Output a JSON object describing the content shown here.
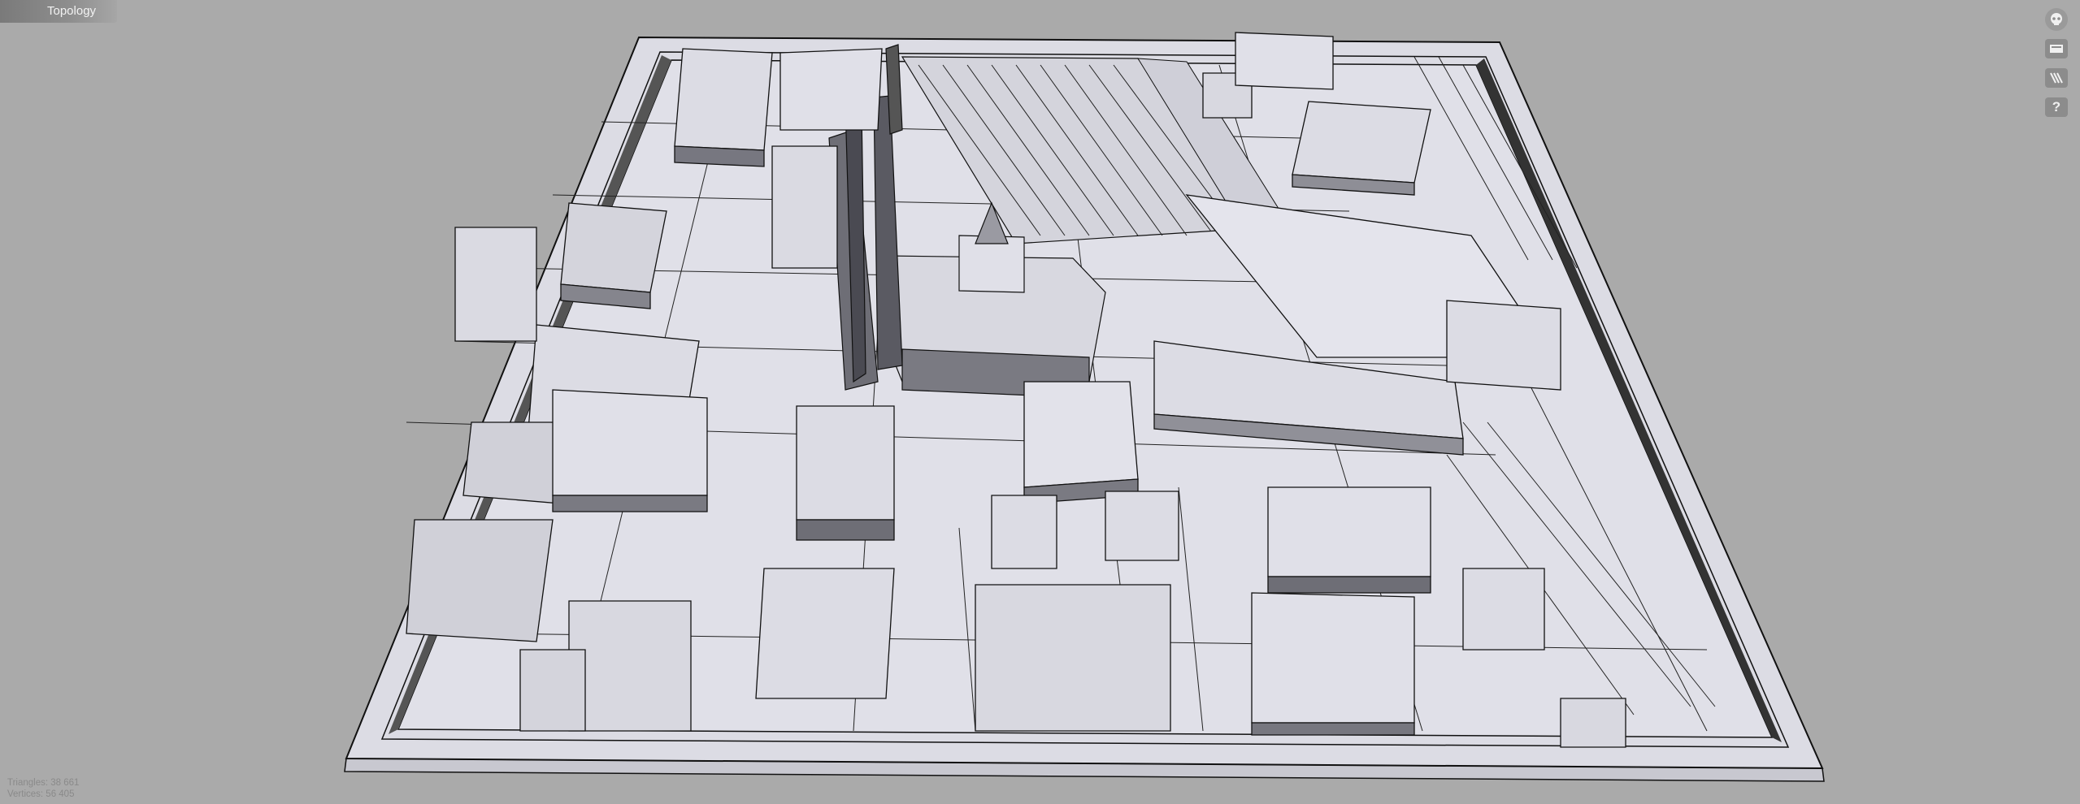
{
  "viewer": {
    "mode_label": "Topology",
    "background_color": "#aaaaaa",
    "model_color": "#dcdce6",
    "edge_color": "#111111"
  },
  "toolbar": {
    "buttons": [
      {
        "name": "view-mode-button",
        "icon": "eye-icon"
      },
      {
        "name": "layer-button",
        "icon": "layer-icon"
      },
      {
        "name": "wireframe-button",
        "icon": "wireframe-icon"
      },
      {
        "name": "help-button",
        "icon": "question-icon",
        "label": "?"
      }
    ]
  },
  "stats": {
    "triangles_text": "Triangles: 38 661",
    "vertices_text": "Vertices: 56 405"
  }
}
